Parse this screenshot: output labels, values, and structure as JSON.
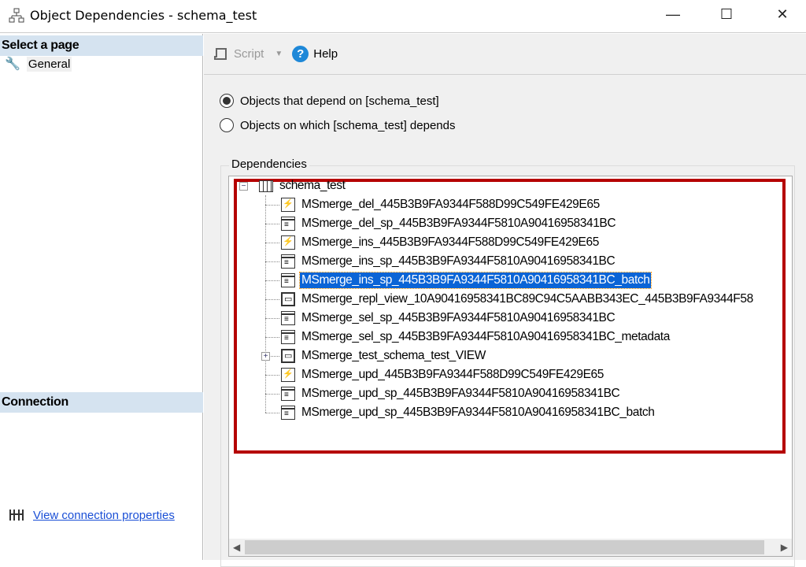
{
  "window": {
    "title": "Object Dependencies - schema_test",
    "minimize": "—",
    "maximize": "☐",
    "close": "✕"
  },
  "left": {
    "select_page": "Select a page",
    "pages": [
      {
        "label": "General"
      }
    ],
    "connection": "Connection",
    "view_connection": "View connection properties"
  },
  "toolbar": {
    "script": "Script",
    "help": "Help"
  },
  "options": {
    "depend_on": "Objects that depend on [schema_test]",
    "depends": "Objects on which [schema_test] depends",
    "selected": "depend_on"
  },
  "group": {
    "label": "Dependencies"
  },
  "tree": {
    "root": "schema_test",
    "items": [
      {
        "label": "MSmerge_del_445B3B9FA9344F588D99C549FE429E65",
        "type": "trigger"
      },
      {
        "label": "MSmerge_del_sp_445B3B9FA9344F5810A90416958341BC",
        "type": "sp"
      },
      {
        "label": "MSmerge_ins_445B3B9FA9344F588D99C549FE429E65",
        "type": "trigger"
      },
      {
        "label": "MSmerge_ins_sp_445B3B9FA9344F5810A90416958341BC",
        "type": "sp"
      },
      {
        "label": "MSmerge_ins_sp_445B3B9FA9344F5810A90416958341BC_batch",
        "type": "sp",
        "selected": true
      },
      {
        "label": "MSmerge_repl_view_10A90416958341BC89C94C5AABB343EC_445B3B9FA9344F58",
        "type": "view"
      },
      {
        "label": "MSmerge_sel_sp_445B3B9FA9344F5810A90416958341BC",
        "type": "sp"
      },
      {
        "label": "MSmerge_sel_sp_445B3B9FA9344F5810A90416958341BC_metadata",
        "type": "sp"
      },
      {
        "label": "MSmerge_test_schema_test_VIEW",
        "type": "view",
        "expandable": true
      },
      {
        "label": "MSmerge_upd_445B3B9FA9344F588D99C549FE429E65",
        "type": "trigger"
      },
      {
        "label": "MSmerge_upd_sp_445B3B9FA9344F5810A90416958341BC",
        "type": "sp"
      },
      {
        "label": "MSmerge_upd_sp_445B3B9FA9344F5810A90416958341BC_batch",
        "type": "sp"
      }
    ]
  },
  "colors": {
    "highlight": "#b50000",
    "selection": "#0a64d6",
    "help": "#1e88d8"
  }
}
